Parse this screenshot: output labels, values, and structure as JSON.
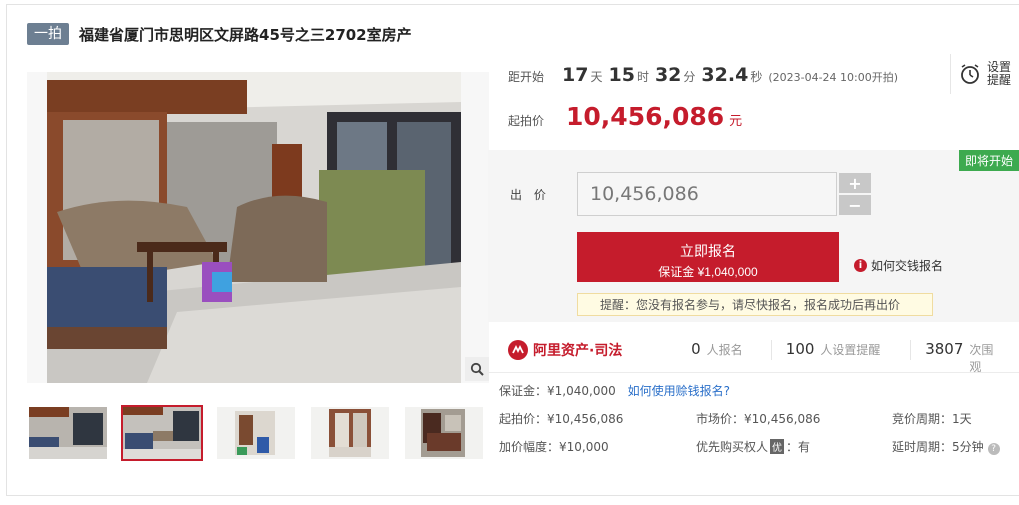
{
  "title": {
    "badge": "一拍",
    "text": "福建省厦门市思明区文屏路45号之三2702室房产"
  },
  "countdown": {
    "label": "距开始",
    "days": "17",
    "days_unit": "天",
    "hours": "15",
    "hours_unit": "时",
    "minutes": "32",
    "minutes_unit": "分",
    "seconds": "32.4",
    "seconds_unit": "秒",
    "start_note": "(2023-04-24 10:00开拍)"
  },
  "remind": {
    "text": "设置提醒",
    "icon": "alarm-clock-icon"
  },
  "starting_price": {
    "label": "起拍价",
    "value": "10,456,086",
    "unit": "元"
  },
  "bid": {
    "status_badge": "即将开始",
    "label": "出 价",
    "input_value": "10,456,086",
    "plus": "+",
    "minus": "−",
    "signup_main": "立即报名",
    "signup_sub": "保证金 ¥1,040,000",
    "how_pay": "如何交钱报名",
    "tip": "提醒：您没有报名参与，请尽快报名，报名成功后再出价"
  },
  "stats": {
    "logo_text": "阿里资产·司法",
    "signups": "0",
    "signups_unit": "人报名",
    "reminders": "100",
    "reminders_unit": "人设置提醒",
    "views": "3807",
    "views_unit": "次围观"
  },
  "details": {
    "deposit_label": "保证金：",
    "deposit_value": "¥1,040,000",
    "deposit_link": "如何使用赊钱报名?",
    "start_price_label": "起拍价：",
    "start_price_value": "¥10,456,086",
    "market_price_label": "市场价：",
    "market_price_value": "¥10,456,086",
    "cycle_label": "竞价周期：",
    "cycle_value": "1天",
    "increment_label": "加价幅度：",
    "increment_value": "¥10,000",
    "priority_label": "优先购买权人",
    "priority_tag": "优",
    "priority_value": "：有",
    "delay_label": "延时周期：",
    "delay_value": "5分钟"
  },
  "colors": {
    "accent_red": "#c51c2c",
    "badge_green": "#3daa4f",
    "badge_gray": "#6d7f92",
    "link_blue": "#2a6fc9"
  }
}
